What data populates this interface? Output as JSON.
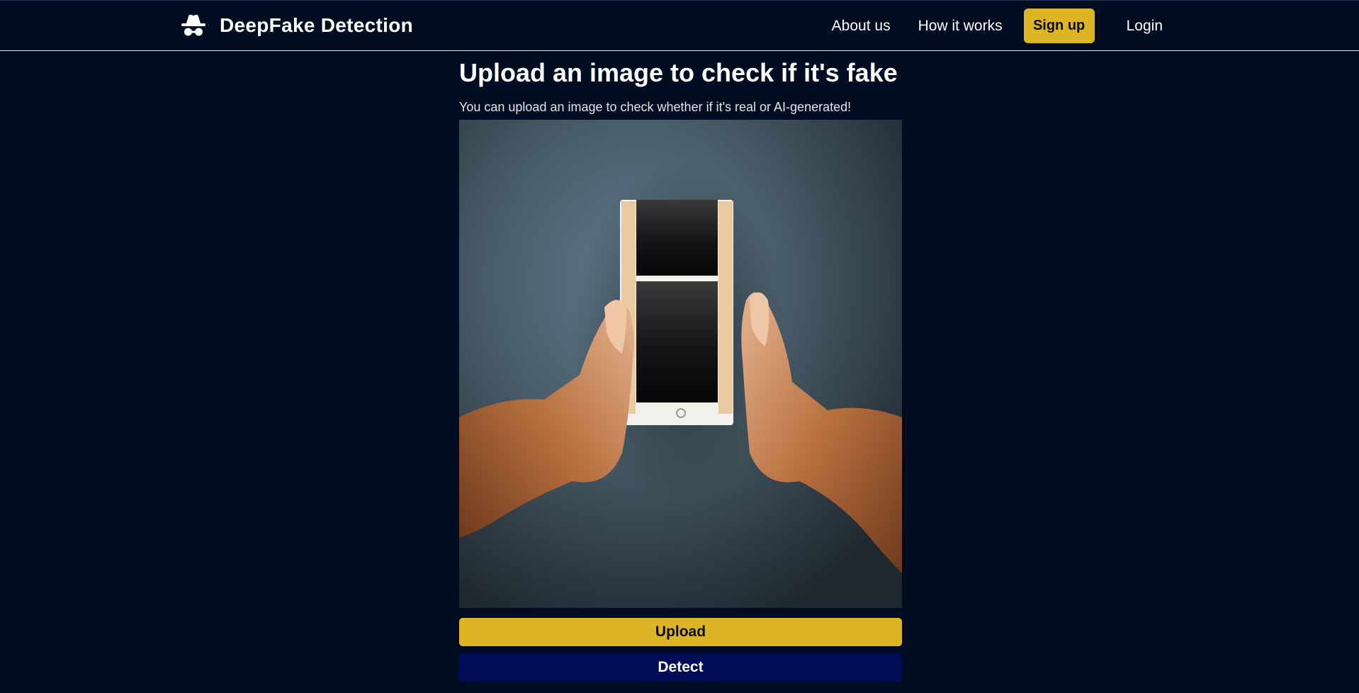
{
  "navbar": {
    "brand_icon": "incognito-spy-icon",
    "brand_title": "DeepFake Detection",
    "links": {
      "about": "About us",
      "how": "How it works",
      "signup": "Sign up",
      "login": "Login"
    }
  },
  "main": {
    "title": "Upload an image to check if it's fake",
    "subtitle": "You can upload an image to check whether if it's real or AI-generated!",
    "upload_label": "Upload",
    "detect_label": "Detect"
  },
  "colors": {
    "background": "#000c21",
    "accent": "#ddb524",
    "detect_button": "#010d57"
  }
}
